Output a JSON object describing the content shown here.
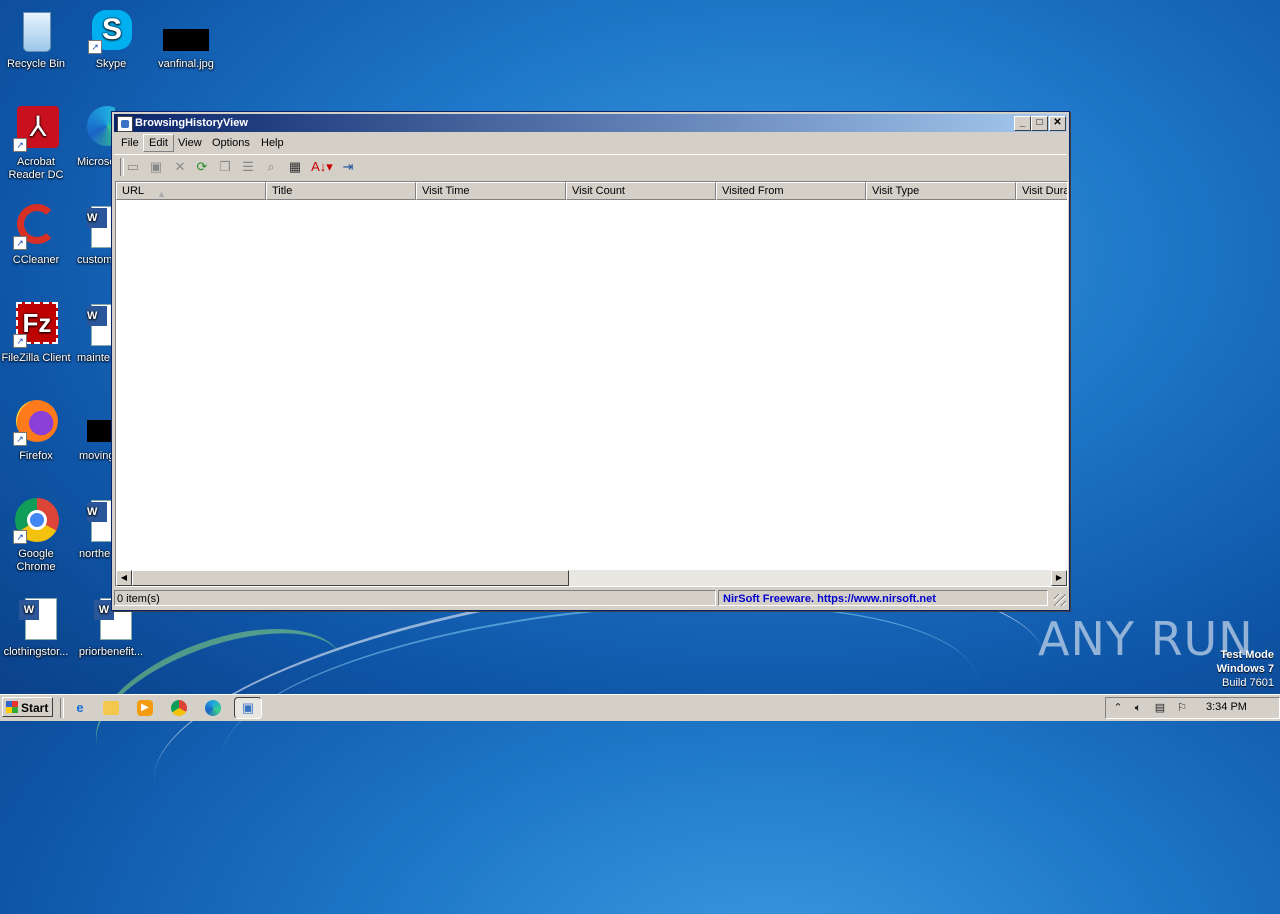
{
  "desktop": {
    "icons": [
      {
        "label": "Recycle Bin"
      },
      {
        "label": "Skype"
      },
      {
        "label": "vanfinal.jpg"
      },
      {
        "label": "Acrobat Reader DC"
      },
      {
        "label": "Microso"
      },
      {
        "label": "CCleaner"
      },
      {
        "label": "custom"
      },
      {
        "label": "FileZilla Client"
      },
      {
        "label": "mainte"
      },
      {
        "label": "Firefox"
      },
      {
        "label": "moving"
      },
      {
        "label": "Google Chrome"
      },
      {
        "label": "northe"
      },
      {
        "label": "clothingstor..."
      },
      {
        "label": "priorbenefit..."
      }
    ]
  },
  "window": {
    "title": "BrowsingHistoryView",
    "menu": [
      "File",
      "Edit",
      "View",
      "Options",
      "Help"
    ],
    "toolbar_icons": [
      "open-icon",
      "save-icon",
      "delete-icon",
      "refresh-icon",
      "copy-icon",
      "properties-icon",
      "find-icon",
      "html-report-icon",
      "sort-icon",
      "exit-icon"
    ],
    "columns": [
      "URL",
      "Title",
      "Visit Time",
      "Visit Count",
      "Visited From",
      "Visit Type",
      "Visit Dura"
    ],
    "status": {
      "items": "0 item(s)",
      "credit": "NirSoft Freeware. https://www.nirsoft.net"
    }
  },
  "watermark": {
    "brand": "ANY RUN",
    "test_mode": "Test Mode",
    "os": "Windows 7",
    "build": "Build 7601"
  },
  "taskbar": {
    "start_label": "Start",
    "clock": "3:34 PM",
    "pinned": [
      "internet-explorer-icon",
      "explorer-icon",
      "media-player-icon",
      "chrome-icon",
      "edge-icon",
      "browsinghistoryview-icon"
    ]
  },
  "colors": {
    "titlebar_start": "#0a246a",
    "titlebar_end": "#a6caf0",
    "status_link": "#0000cc",
    "desktop": "#1f78c9"
  }
}
